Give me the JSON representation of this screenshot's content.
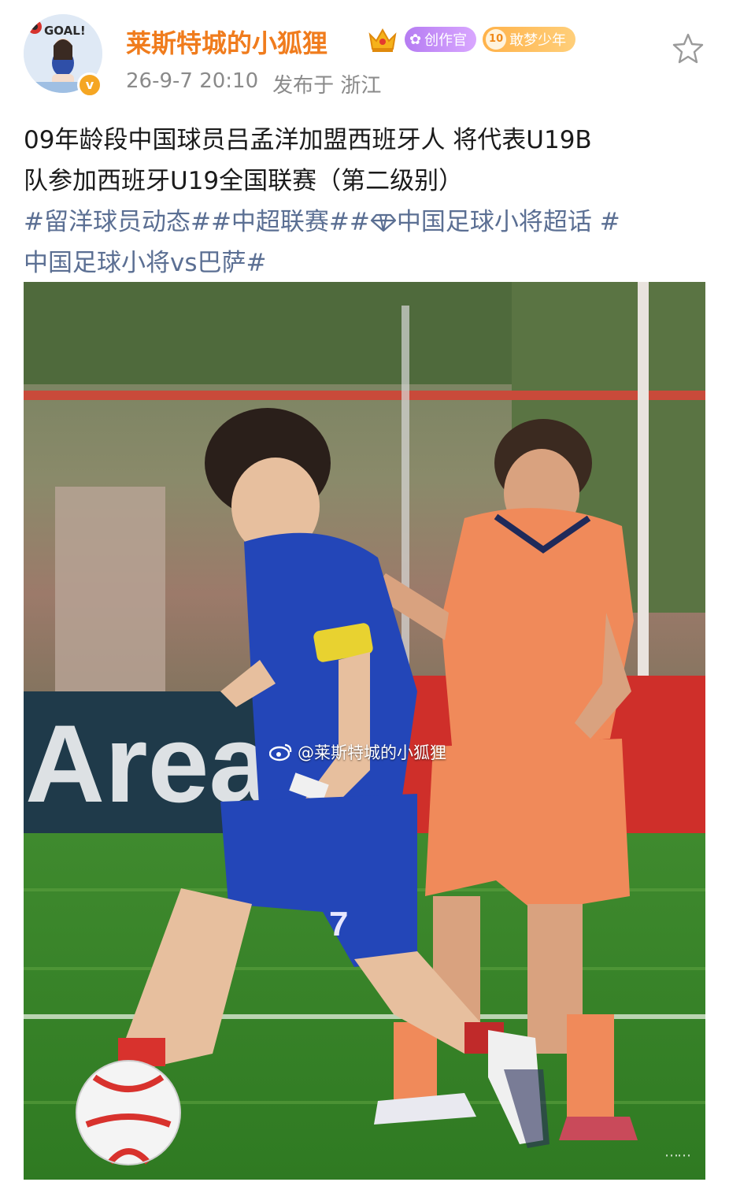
{
  "post": {
    "user": {
      "name": "莱斯特城的小狐狸",
      "avatar_text": "GOAL!",
      "verified_icon": "verified-badge-icon",
      "badges": {
        "creator": "创作官",
        "dream_level": "10",
        "dream": "敢梦少年"
      }
    },
    "meta": {
      "time": "26-9-7 20:10",
      "location": "发布于 浙江"
    },
    "text": {
      "line1": "09年龄段中国球员吕孟洋加盟西班牙人 将代表U19B",
      "line2": "队参加西班牙U19全国联赛（第二级别）",
      "tag1": "#留洋球员动态#",
      "tag2": "#中超联赛#",
      "tag3_prefix": "#",
      "tag3_rest": "中国足球小将超话 #",
      "tag4": "中国足球小将vs巴萨#"
    },
    "image": {
      "watermark": "@莱斯特城的小狐狸",
      "ad_board_text": "Area",
      "corner_mark": "⋯⋯",
      "jersey_number": "7"
    }
  }
}
